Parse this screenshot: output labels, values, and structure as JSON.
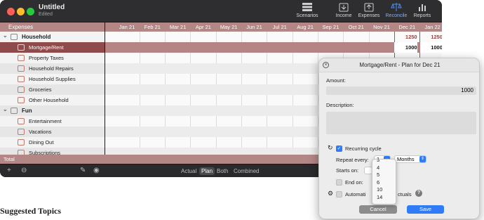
{
  "window": {
    "title": "Untitled",
    "subtitle": "Edited"
  },
  "toolbar": {
    "items": [
      {
        "label": "Scenarios",
        "icon": "scenarios-icon"
      },
      {
        "label": "Income",
        "icon": "income-icon"
      },
      {
        "label": "Expenses",
        "icon": "expenses-icon"
      },
      {
        "label": "Reconcile",
        "icon": "reconcile-icon"
      },
      {
        "label": "Reports",
        "icon": "reports-icon"
      }
    ]
  },
  "sidebar": {
    "header": "Expenses",
    "rows": [
      {
        "label": "Household",
        "type": "group",
        "icon": "house-icon"
      },
      {
        "label": "Mortgage/Rent",
        "type": "item",
        "icon": "building-icon",
        "selected": true
      },
      {
        "label": "Property Taxes",
        "type": "item",
        "icon": "document-icon"
      },
      {
        "label": "Household Repairs",
        "type": "item",
        "icon": "tools-icon"
      },
      {
        "label": "Household Supplies",
        "type": "item",
        "icon": "box-icon"
      },
      {
        "label": "Groceries",
        "type": "item",
        "icon": "cart-icon"
      },
      {
        "label": "Other Household",
        "type": "item",
        "icon": "key-icon"
      },
      {
        "label": "Fun",
        "type": "group",
        "icon": "smile-icon"
      },
      {
        "label": "Entertainment",
        "type": "item",
        "icon": "play-icon"
      },
      {
        "label": "Vacations",
        "type": "item",
        "icon": "suitcase-icon"
      },
      {
        "label": "Dining Out",
        "type": "item",
        "icon": "fork-icon"
      },
      {
        "label": "Subscriptions",
        "type": "item",
        "icon": "list-icon"
      }
    ]
  },
  "grid": {
    "months": [
      "Jan 21",
      "Feb 21",
      "Mar 21",
      "Apr 21",
      "May 21",
      "Jun 21",
      "Jul 21",
      "Aug 21",
      "Sep 21",
      "Oct 21",
      "Nov 21",
      "Dec 21",
      "Jan 22"
    ],
    "group_total_dec": "1250",
    "group_total_jan": "1250",
    "selected_dec": "1000",
    "selected_jan": "1000"
  },
  "total_label": "Total",
  "bottom": {
    "modes": [
      "Actual",
      "Plan",
      "Both",
      "Combined"
    ],
    "active_mode": "Plan"
  },
  "panel": {
    "title": "Mortgage/Rent - Plan for Dec 21",
    "amount_label": "Amount:",
    "amount_value": "1000",
    "description_label": "Description:",
    "recurring_label": "Recurring cycle",
    "repeat_label": "Repeat every:",
    "repeat_value": "1",
    "unit_value": "Months",
    "starts_label": "Starts on:",
    "end_label": "End on:",
    "auto_label_start": "Automati",
    "auto_label_end": "ctuals",
    "cancel": "Cancel",
    "save": "Save"
  },
  "dropdown": {
    "options": [
      "3",
      "4",
      "5",
      "6",
      "10",
      "14"
    ]
  },
  "page": {
    "suggested": "Suggested Topics"
  },
  "colors": {
    "accent": "#b38786",
    "selected": "#8e4b4b",
    "blue": "#2f7cf6",
    "red_text": "#9a3f3f"
  }
}
